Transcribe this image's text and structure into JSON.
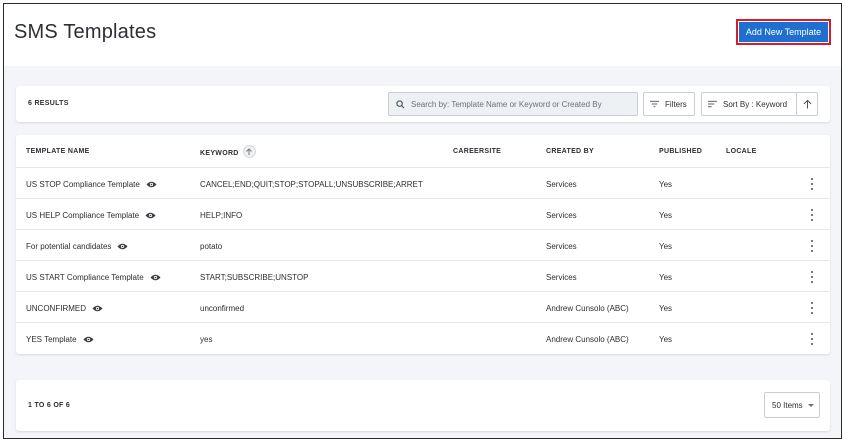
{
  "header": {
    "title": "SMS Templates",
    "add_button_label": "Add New Template"
  },
  "toolbar": {
    "results_count": "6 RESULTS",
    "search_placeholder": "Search by: Template Name or Keyword or Created By",
    "filters_label": "Filters",
    "sort_label": "Sort By : Keyword"
  },
  "table": {
    "columns": [
      "TEMPLATE NAME",
      "KEYWORD",
      "CAREERSITE",
      "CREATED BY",
      "PUBLISHED",
      "LOCALE"
    ],
    "rows": [
      {
        "name": "US STOP Compliance Template",
        "keyword": "CANCEL;END;QUIT;STOP;STOPALL;UNSUBSCRIBE;ARRET",
        "careersite": "",
        "created_by": "Services",
        "published": "Yes",
        "locale": ""
      },
      {
        "name": "US HELP Compliance Template",
        "keyword": "HELP;INFO",
        "careersite": "",
        "created_by": "Services",
        "published": "Yes",
        "locale": ""
      },
      {
        "name": "For potential candidates",
        "keyword": "potato",
        "careersite": "",
        "created_by": "Services",
        "published": "Yes",
        "locale": ""
      },
      {
        "name": "US START Compliance Template",
        "keyword": "START;SUBSCRIBE;UNSTOP",
        "careersite": "",
        "created_by": "Services",
        "published": "Yes",
        "locale": ""
      },
      {
        "name": "UNCONFIRMED",
        "keyword": "unconfirmed",
        "careersite": "",
        "created_by": "Andrew Cunsolo (ABC)",
        "published": "Yes",
        "locale": ""
      },
      {
        "name": "YES Template",
        "keyword": "yes",
        "careersite": "",
        "created_by": "Andrew Cunsolo (ABC)",
        "published": "Yes",
        "locale": ""
      }
    ]
  },
  "footer": {
    "page_info": "1 TO 6 OF 6",
    "items_per_page": "50 Items"
  },
  "colors": {
    "primary": "#1f6fd0",
    "highlight_border": "#d41e2b",
    "background": "#f3f5f8"
  }
}
